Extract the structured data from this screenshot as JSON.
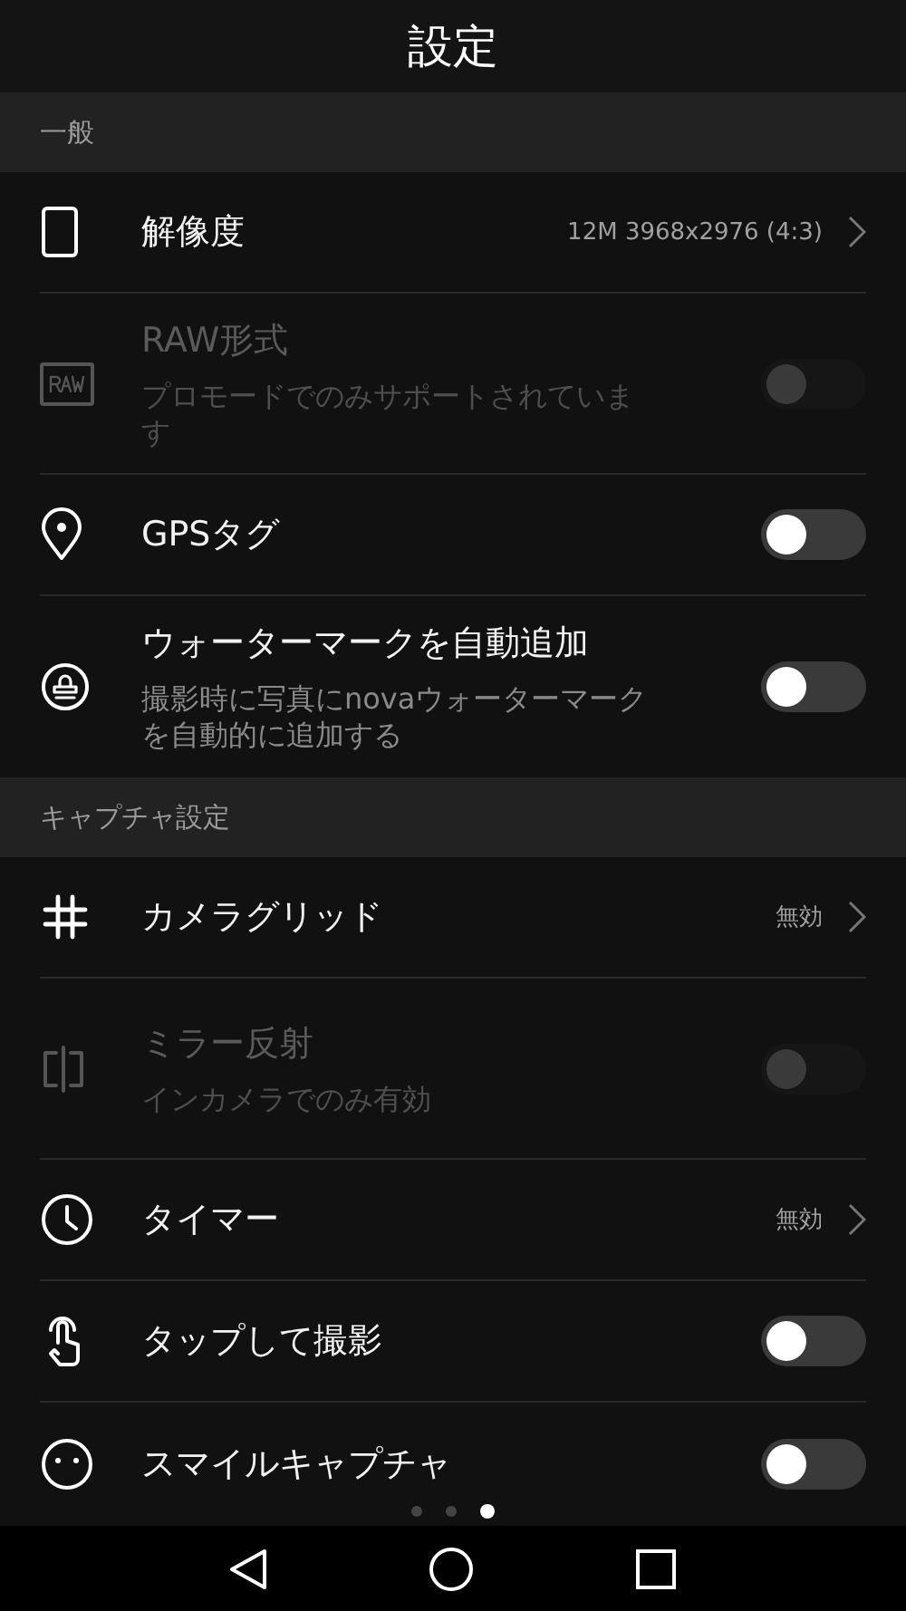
{
  "title": "設定",
  "sections": [
    {
      "header": "一般",
      "items": [
        {
          "kind": "chevron",
          "label": "解像度",
          "value": "12M 3968x2976 (4:3)",
          "disabled": false
        },
        {
          "kind": "toggle",
          "label": "RAW形式",
          "description": "プロモードでのみサポートされています",
          "disabled": true,
          "on": false
        },
        {
          "kind": "toggle",
          "label": "GPSタグ",
          "disabled": false,
          "on": false
        },
        {
          "kind": "toggle",
          "label": "ウォーターマークを自動追加",
          "description": "撮影時に写真にnovaウォーターマークを自動的に追加する",
          "disabled": false,
          "on": false
        }
      ]
    },
    {
      "header": "キャプチャ設定",
      "items": [
        {
          "kind": "chevron",
          "label": "カメラグリッド",
          "value": "無効",
          "disabled": false
        },
        {
          "kind": "toggle",
          "label": "ミラー反射",
          "description": "インカメラでのみ有効",
          "disabled": true,
          "on": false
        },
        {
          "kind": "chevron",
          "label": "タイマー",
          "value": "無効",
          "disabled": false
        },
        {
          "kind": "toggle",
          "label": "タップして撮影",
          "disabled": false,
          "on": false
        },
        {
          "kind": "toggle",
          "label": "スマイルキャプチャ",
          "disabled": false,
          "on": false
        }
      ]
    }
  ],
  "pages": [
    {
      "selected": false
    },
    {
      "selected": false
    },
    {
      "selected": true
    }
  ]
}
